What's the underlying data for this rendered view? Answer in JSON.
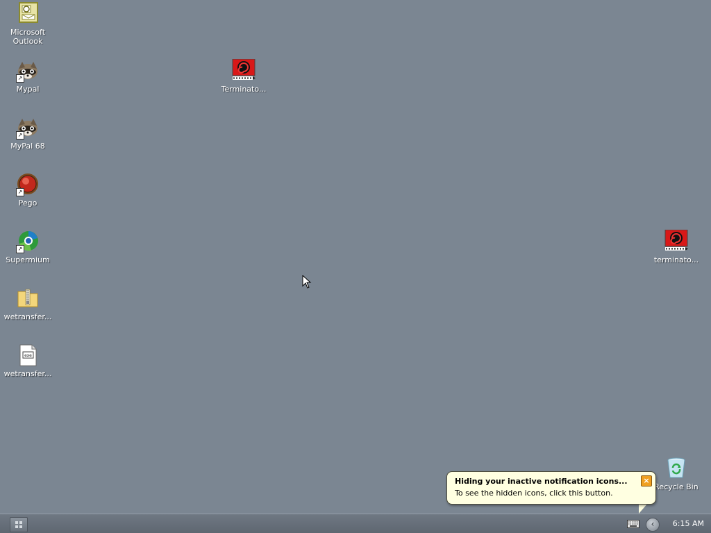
{
  "desktop": {
    "icons": [
      {
        "label": "Microsoft\nOutlook",
        "icon": "outlook-icon"
      },
      {
        "label": "Mypal",
        "icon": "mypal-icon"
      },
      {
        "label": "MyPal 68",
        "icon": "mypal68-icon"
      },
      {
        "label": "Pego",
        "icon": "pego-icon"
      },
      {
        "label": "Supermium",
        "icon": "supermium-icon"
      },
      {
        "label": "wetransfer...",
        "icon": "zip-folder-icon"
      },
      {
        "label": "wetransfer...",
        "icon": "document-icon"
      },
      {
        "label": "Terminato...",
        "icon": "video-file-icon"
      },
      {
        "label": "terminato...",
        "icon": "video-file-icon"
      },
      {
        "label": "Recycle Bin",
        "icon": "recycle-bin-icon"
      }
    ]
  },
  "balloon": {
    "title": "Hiding your inactive notification icons...",
    "text": "To see the hidden icons, click this button.",
    "close_symbol": "×"
  },
  "taskbar": {
    "clock": "6:15 AM",
    "show_hidden_symbol": "‹"
  },
  "colors": {
    "desktop_bg": "#7b8692",
    "balloon_bg": "#ffffe1",
    "taskbar_bg": "#666f79"
  }
}
